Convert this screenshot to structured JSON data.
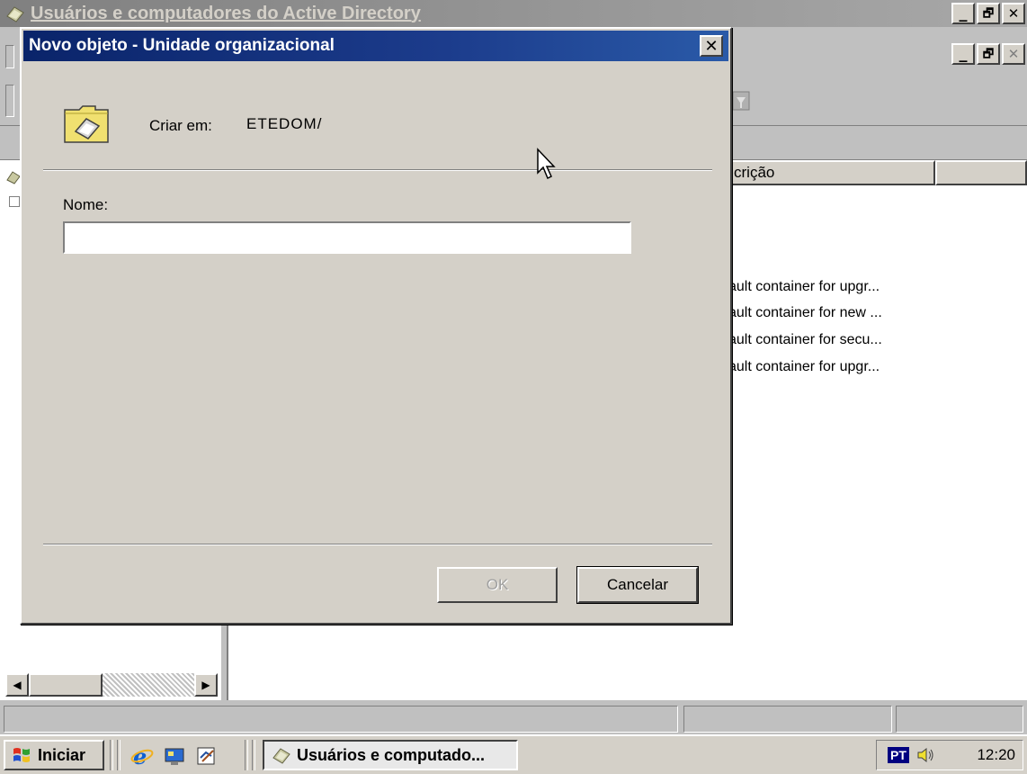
{
  "background_window": {
    "title": "Usuários e computadores do Active Directory",
    "title_controls": [
      "_",
      "🗗",
      "✕"
    ],
    "inner_controls": [
      "_",
      "🗗",
      "✕"
    ],
    "column_header_partial": "crição",
    "list_rows": [
      "ault container for upgr...",
      "ault container for new ...",
      "ault container for secu...",
      "ault container for upgr..."
    ],
    "scroll_left": "◀",
    "scroll_right": "▶"
  },
  "dialog": {
    "title": "Novo objeto - Unidade organizacional",
    "close_glyph": "✕",
    "create_in_label": "Criar em:",
    "create_in_value": "ETEDOM/",
    "name_label": "Nome:",
    "name_value": "",
    "ok_label": "OK",
    "cancel_label": "Cancelar",
    "icon": "folder-ou-icon"
  },
  "taskbar": {
    "start_label": "Iniciar",
    "task_button_label": "Usuários e computado...",
    "language": "PT",
    "clock": "12:20",
    "quick_launch_icons": [
      "ie-icon",
      "desktop-icon",
      "outlook-icon"
    ]
  },
  "colors": {
    "dialog_title": "#0a246a",
    "inactive_title": "#808080",
    "face": "#d4d0c8"
  }
}
